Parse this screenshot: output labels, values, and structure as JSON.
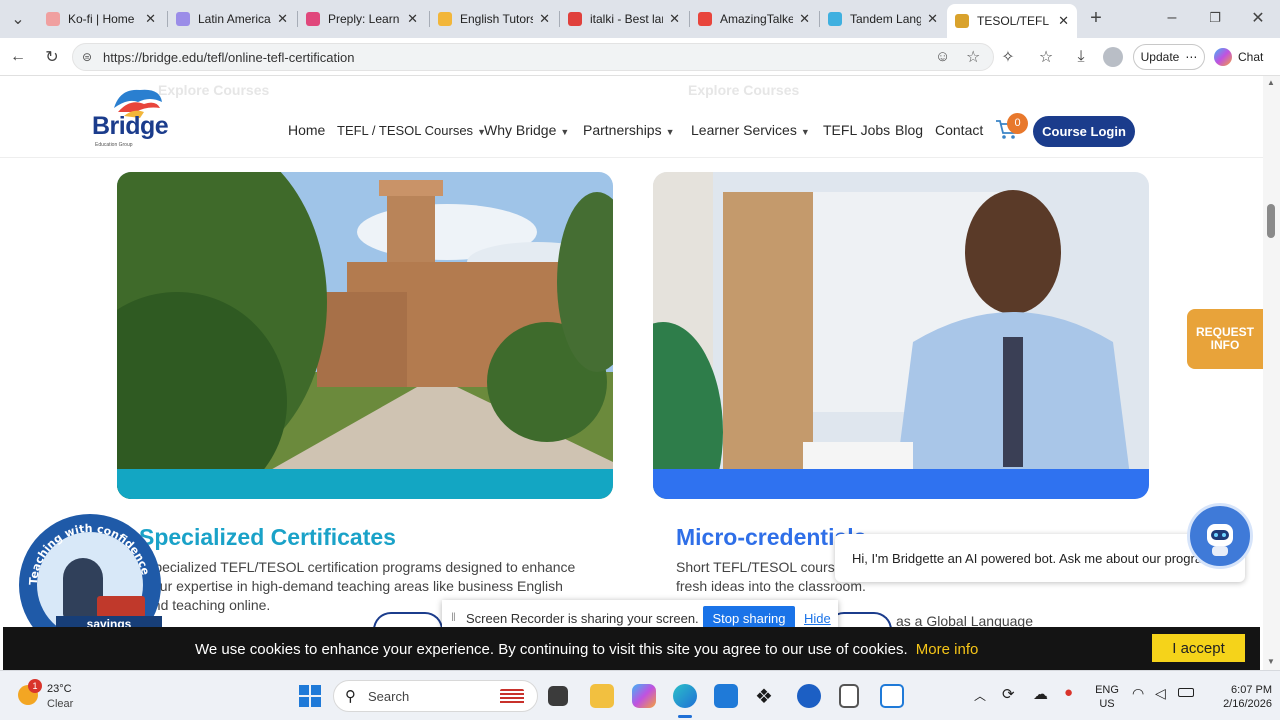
{
  "browser": {
    "tabs": [
      {
        "title": "Ko-fi | Home",
        "color": "#f0a0a0"
      },
      {
        "title": "Latin America re",
        "color": "#9b8de8"
      },
      {
        "title": "Preply: Learn w",
        "color": "#e0487c"
      },
      {
        "title": "English Tutors C",
        "color": "#f2b63a"
      },
      {
        "title": "italki - Best lang",
        "color": "#e0403c"
      },
      {
        "title": "AmazingTalker",
        "color": "#e8453c"
      },
      {
        "title": "Tandem Langua",
        "color": "#3fb0e0"
      },
      {
        "title": "TESOL/TEFL Ce",
        "color": "#d9a22c"
      }
    ],
    "url": "https://bridge.edu/tefl/online-tefl-certification",
    "update_label": "Update",
    "chat_label": "Chat"
  },
  "site": {
    "logo_text": "Bridge",
    "logo_sub": "Education Group",
    "ghost_left": "Explore Courses",
    "ghost_right": "Explore Courses",
    "nav": [
      {
        "label": "Home",
        "dropdown": false
      },
      {
        "label": "TEFL / TESOL Courses",
        "dropdown": true
      },
      {
        "label": "Why Bridge",
        "dropdown": true
      },
      {
        "label": "Partnerships",
        "dropdown": true
      },
      {
        "label": "Learner Services",
        "dropdown": true
      },
      {
        "label": "TEFL Jobs",
        "dropdown": false
      },
      {
        "label": "Blog",
        "dropdown": false
      },
      {
        "label": "Contact",
        "dropdown": false
      }
    ],
    "cart_count": "0",
    "course_login": "Course Login",
    "request_info": "REQUEST INFO",
    "brand_color": "#1b3c8c"
  },
  "cards": [
    {
      "title": "Specialized Certificates",
      "title_color": "#1aa2c8",
      "band_color": "#12a5c2",
      "text": "Specialized TEFL/TESOL certification programs designed to enhance your expertise in high-demand teaching areas like business English and teaching online."
    },
    {
      "title": "Micro-credentials",
      "title_color": "#2f6fe8",
      "band_color": "#2f72f0",
      "text": "Short TEFL/TESOL courses that refine your skills, and bring fresh ideas into the classroom.",
      "partial_link": "as a Global Language"
    }
  ],
  "badge": {
    "text": "Teaching with confidence",
    "banner": "savings"
  },
  "chatbot": {
    "message": "Hi, I'm Bridgette an AI powered bot. Ask me about our programs!"
  },
  "recorder": {
    "message": "Screen Recorder is sharing your screen.",
    "stop_label": "Stop sharing",
    "hide_label": "Hide"
  },
  "cookie": {
    "message": "We use cookies to enhance your experience. By continuing to visit this site you agree to our use of cookies.",
    "more_info": "More info",
    "accept": "I accept"
  },
  "taskbar": {
    "weather_temp": "23°C",
    "weather_desc": "Clear",
    "weather_badge": "1",
    "search_placeholder": "Search",
    "lang_line1": "ENG",
    "lang_line2": "US",
    "time": "6:07 PM",
    "date": "2/16/2026"
  }
}
